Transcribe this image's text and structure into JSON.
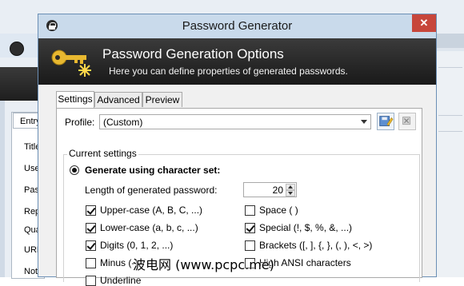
{
  "background_window": {
    "tab_entry": "Entry",
    "labels": [
      "Title",
      "Use",
      "Pas",
      "Rep",
      "Qua",
      "URL",
      "Note"
    ]
  },
  "dialog": {
    "title": "Password Generator",
    "close_glyph": "✕"
  },
  "banner": {
    "title": "Password Generation Options",
    "subtitle": "Here you can define properties of generated passwords."
  },
  "tabs": [
    "Settings",
    "Advanced",
    "Preview"
  ],
  "profile": {
    "label": "Profile:",
    "value": "(Custom)"
  },
  "current_settings": {
    "group_title": "Current settings",
    "radio_label": "Generate using character set:",
    "length_label": "Length of generated password:",
    "length_value": "20",
    "left_options": [
      {
        "label": "Upper-case (A, B, C, ...)",
        "checked": true
      },
      {
        "label": "Lower-case (a, b, c, ...)",
        "checked": true
      },
      {
        "label": "Digits (0, 1, 2, ...)",
        "checked": true
      },
      {
        "label": "Minus (-)",
        "checked": false
      },
      {
        "label": "Underline",
        "checked": false
      }
    ],
    "right_options": [
      {
        "label": "Space ( )",
        "checked": false
      },
      {
        "label": "Special (!, $, %, &, ...)",
        "checked": true
      },
      {
        "label": "Brackets ([, ], {, }, (, ), <, >)",
        "checked": false
      },
      {
        "label": "High ANSI characters",
        "checked": false
      }
    ]
  },
  "watermark": "波电网 (www.pcpc.me)",
  "colors": {
    "banner_bg": "#232323",
    "titlebar_bg": "#c9daeb",
    "close_button": "#c7463b"
  }
}
